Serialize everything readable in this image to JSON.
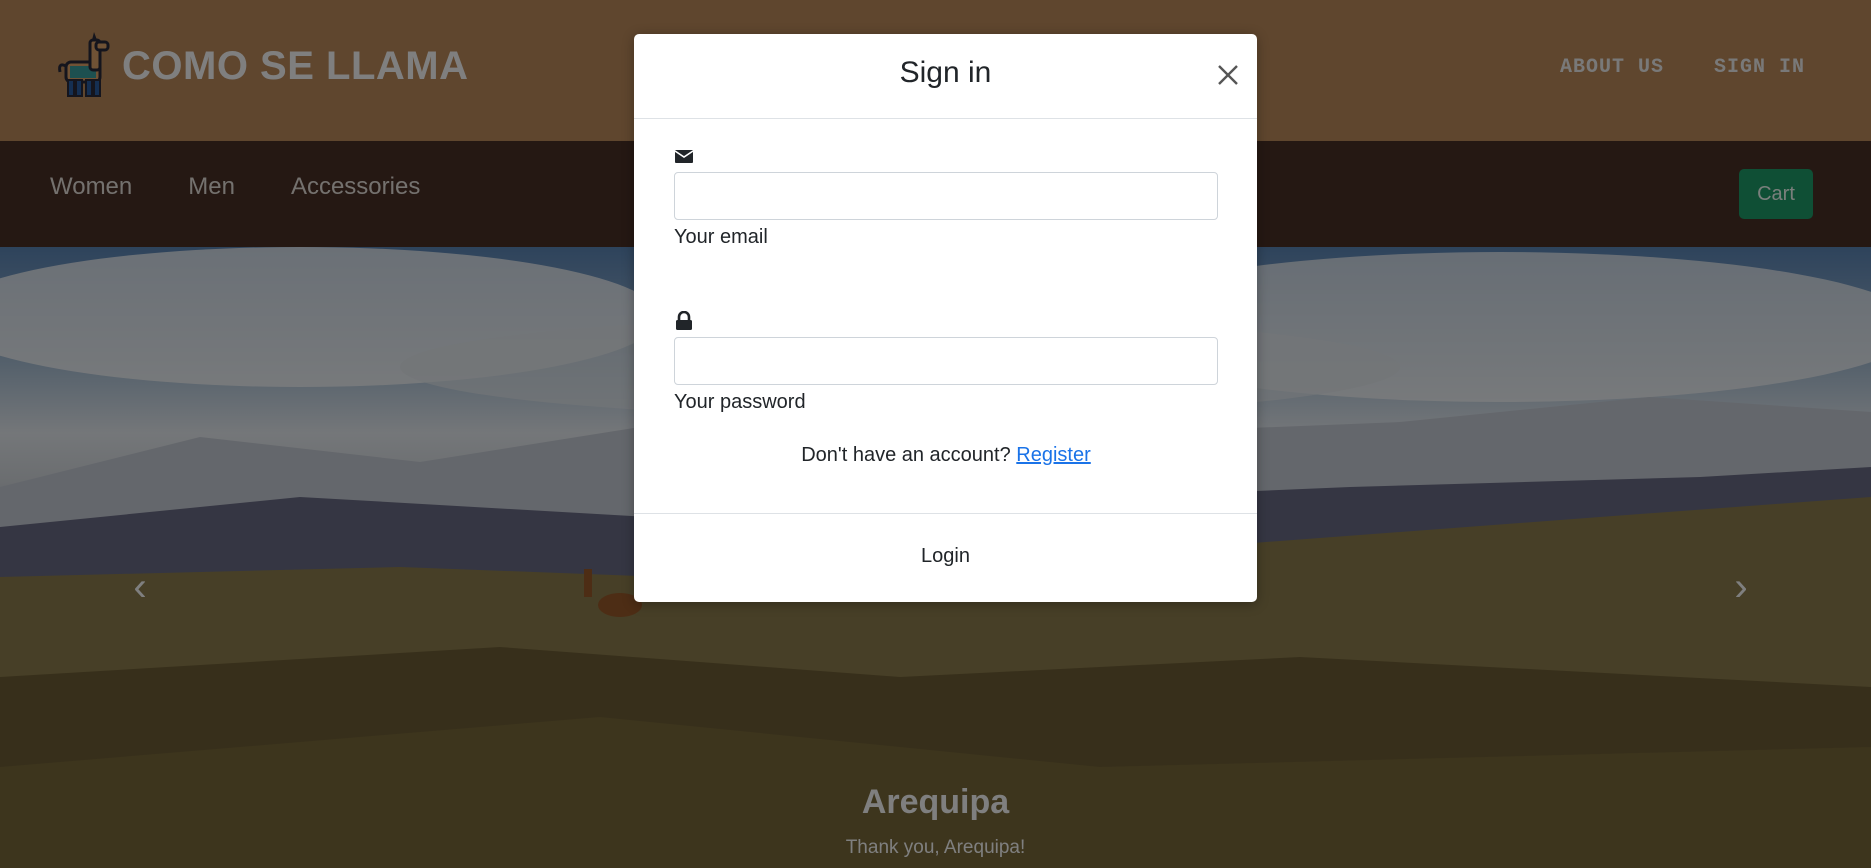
{
  "header": {
    "brand_name": "COMO SE LLAMA",
    "links": [
      "ABOUT US",
      "SIGN IN"
    ]
  },
  "nav": {
    "items": [
      "Women",
      "Men",
      "Accessories"
    ],
    "cart_label": "Cart"
  },
  "hero": {
    "caption_title": "Arequipa",
    "caption_subtitle": "Thank you, Arequipa!"
  },
  "modal": {
    "title": "Sign in",
    "email": {
      "label": "Your email",
      "value": ""
    },
    "password": {
      "label": "Your password",
      "value": ""
    },
    "register_prompt": "Don't have an account?",
    "register_link": "Register",
    "login_label": "Login"
  },
  "colors": {
    "header_bg": "#bf8d5c",
    "nav_bg": "#4a3026",
    "cart_button": "#1f9e6a",
    "link": "#1a73e8"
  }
}
